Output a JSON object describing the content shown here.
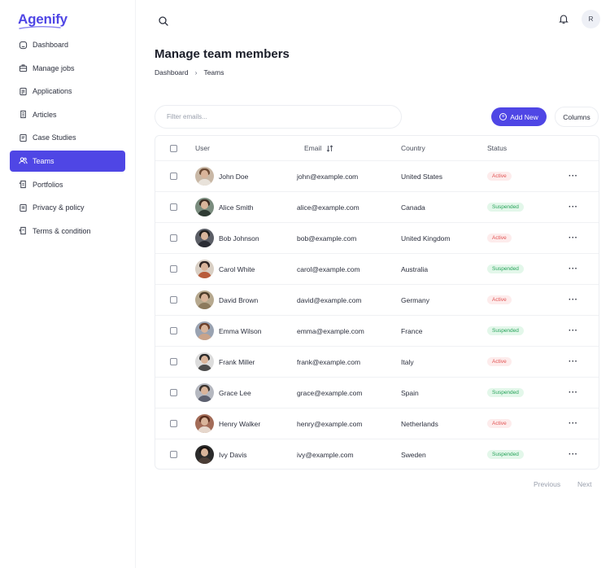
{
  "app": {
    "logo": "Agenify"
  },
  "sidebar": {
    "items": [
      {
        "label": "Dashboard",
        "icon": "dashboard-icon"
      },
      {
        "label": "Manage jobs",
        "icon": "briefcase-icon"
      },
      {
        "label": "Applications",
        "icon": "document-icon"
      },
      {
        "label": "Articles",
        "icon": "article-icon"
      },
      {
        "label": "Case Studies",
        "icon": "case-study-icon"
      },
      {
        "label": "Teams",
        "icon": "users-icon",
        "active": true
      },
      {
        "label": "Portfolios",
        "icon": "portfolio-icon"
      },
      {
        "label": "Privacy & policy",
        "icon": "shield-icon"
      },
      {
        "label": "Terms & condition",
        "icon": "terms-icon"
      }
    ]
  },
  "header": {
    "avatar_initial": "R"
  },
  "page": {
    "title": "Manage team members",
    "breadcrumb": [
      "Dashboard",
      "Teams"
    ]
  },
  "toolbar": {
    "filter_placeholder": "Filter emails...",
    "add_label": "Add New",
    "columns_label": "Columns"
  },
  "table": {
    "columns": {
      "user": "User",
      "email": "Email",
      "country": "Country",
      "status": "Status"
    },
    "rows": [
      {
        "name": "John Doe",
        "email": "john@example.com",
        "country": "United States",
        "status": "Active"
      },
      {
        "name": "Alice Smith",
        "email": "alice@example.com",
        "country": "Canada",
        "status": "Suspended"
      },
      {
        "name": "Bob Johnson",
        "email": "bob@example.com",
        "country": "United Kingdom",
        "status": "Active"
      },
      {
        "name": "Carol White",
        "email": "carol@example.com",
        "country": "Australia",
        "status": "Suspended"
      },
      {
        "name": "David Brown",
        "email": "david@example.com",
        "country": "Germany",
        "status": "Active"
      },
      {
        "name": "Emma Wilson",
        "email": "emma@example.com",
        "country": "France",
        "status": "Suspended"
      },
      {
        "name": "Frank Miller",
        "email": "frank@example.com",
        "country": "Italy",
        "status": "Active"
      },
      {
        "name": "Grace Lee",
        "email": "grace@example.com",
        "country": "Spain",
        "status": "Suspended"
      },
      {
        "name": "Henry Walker",
        "email": "henry@example.com",
        "country": "Netherlands",
        "status": "Active"
      },
      {
        "name": "Ivy Davis",
        "email": "ivy@example.com",
        "country": "Sweden",
        "status": "Suspended"
      }
    ]
  },
  "pagination": {
    "previous": "Previous",
    "next": "Next"
  },
  "colors": {
    "accent": "#4f46e5",
    "active_badge": "#e25555",
    "suspended_badge": "#27a35a"
  }
}
